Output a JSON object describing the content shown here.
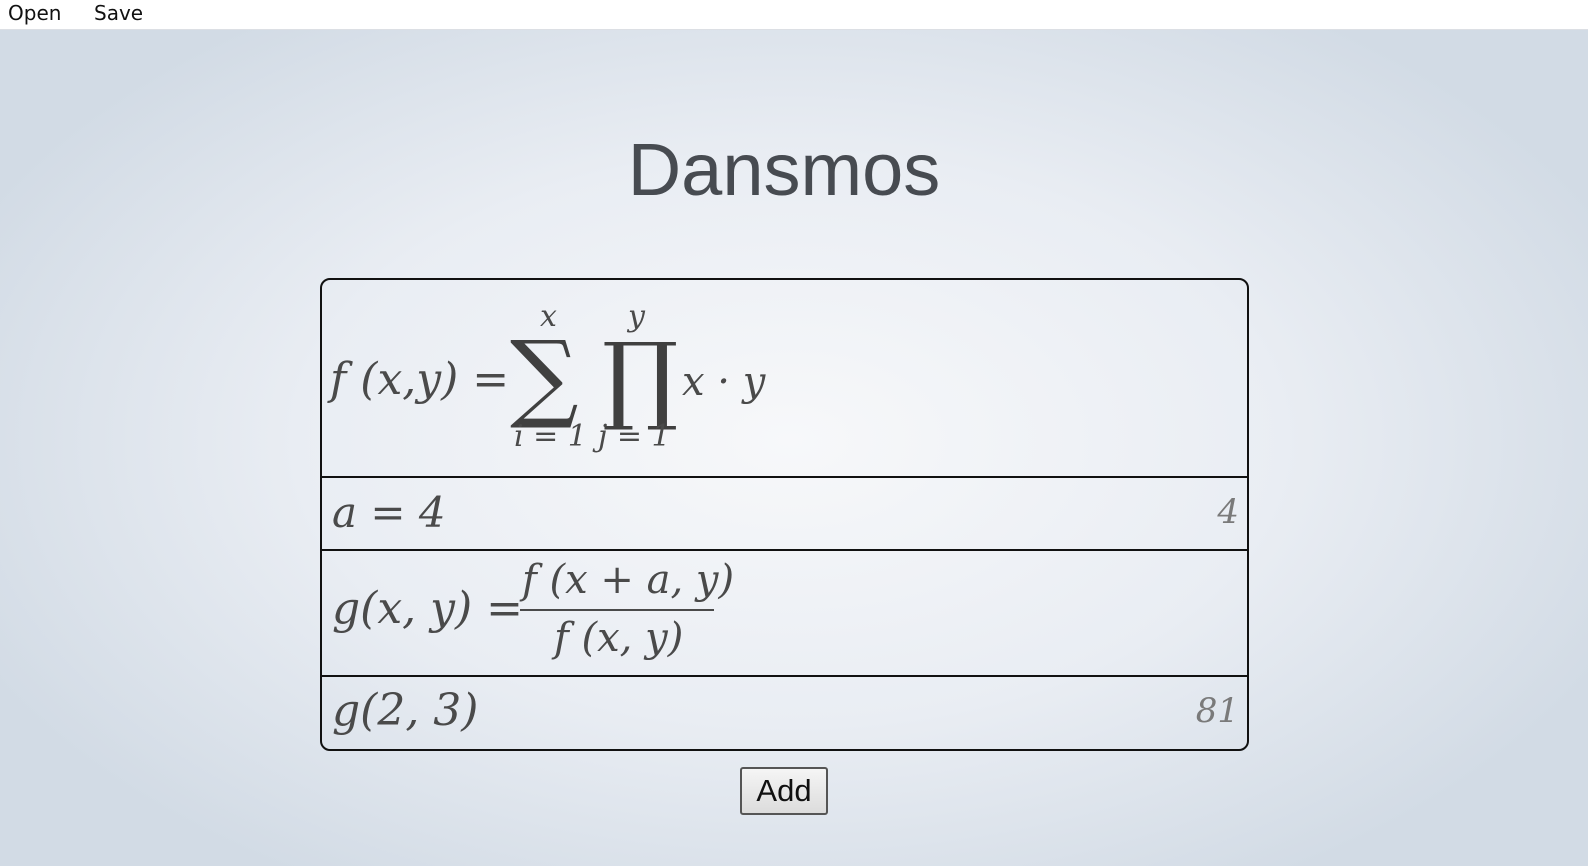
{
  "menu": {
    "open_label": "Open",
    "save_label": "Save"
  },
  "app": {
    "title": "Dansmos"
  },
  "expressions": [
    {
      "lhs": "f (x,y) =",
      "sum_upper": "x",
      "sum_lower": "i = 1",
      "sum_symbol": "∑",
      "prod_upper": "y",
      "prod_lower": "j = 1",
      "prod_symbol": "∏",
      "body": "x · y",
      "result": ""
    },
    {
      "expr": "a = 4",
      "result": "4"
    },
    {
      "lhs": "g(x, y) =",
      "numerator": "f (x + a, y)",
      "denominator": "f (x, y)",
      "result": ""
    },
    {
      "expr": "g(2, 3)",
      "result": "81"
    }
  ],
  "actions": {
    "add_label": "Add"
  }
}
